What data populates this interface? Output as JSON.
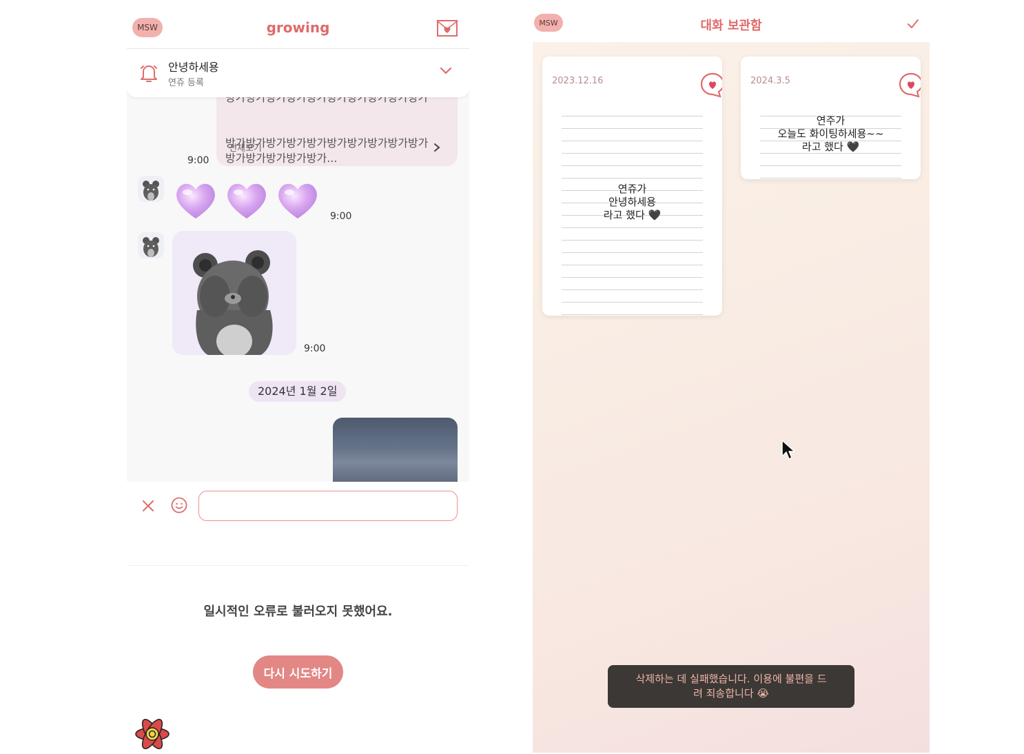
{
  "left": {
    "profile_badge": "MSW",
    "app_title": "growing",
    "notice": {
      "title": "안녕하세용",
      "subtitle": "연쥬 등록"
    },
    "long_message": {
      "lines_cut": "방가방가방가방가방가방가방가방가방가방가",
      "lines": "방가방가방가방가방가방가방가방가방가방가\n방가방가방가방가방가...",
      "more_label": "전체보기",
      "time": "9:00"
    },
    "hearts_message": {
      "time": "9:00"
    },
    "sticker_message": {
      "time": "9:00"
    },
    "date_chip": "2024년 1월 2일",
    "input": {
      "value": "",
      "placeholder": ""
    },
    "error_text": "일시적인 오류로 불러오지 못했어요.",
    "retry_label": "다시 시도하기"
  },
  "right": {
    "profile_badge": "MSW",
    "title": "대화 보관함",
    "cards": [
      {
        "date": "2023.12.16",
        "text": "연쥬가\n안녕하세용\n라고 했다 🖤"
      },
      {
        "date": "2024.3.5",
        "text": "연주가\n오늘도 화이팅하세용~~\n라고 했다 🖤"
      }
    ],
    "toast": "삭제하는 데 실패했습니다. 이용에 불편을 드\n려 죄송합니다 😭"
  },
  "colors": {
    "accent": "#e06a6a",
    "badge": "#f2b1ad",
    "bubble": "#f3e7ec",
    "toast_bg": "#3b3836",
    "toast_text": "#f0b5a6"
  },
  "icons": [
    "letter-heart-icon",
    "bell-icon",
    "chevron-down-icon",
    "chevron-right-icon",
    "close-icon",
    "smile-icon",
    "react-icon",
    "check-icon",
    "bubble-heart-icon",
    "cursor-icon"
  ]
}
